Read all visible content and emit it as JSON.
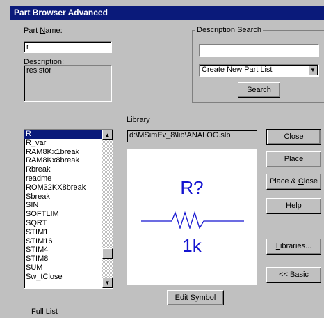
{
  "window": {
    "title": "Part Browser Advanced"
  },
  "part_name": {
    "label_pre": "Part ",
    "label_key": "N",
    "label_post": "ame:",
    "value": "r"
  },
  "description": {
    "label": "Description:",
    "value": "resistor"
  },
  "description_search": {
    "title_key": "D",
    "title_rest": "escription Search",
    "input_value": "",
    "combo_value": "Create New Part List",
    "search_key": "S",
    "search_rest": "earch"
  },
  "library": {
    "label": "Library",
    "path": "d:\\MSimEv_8\\lib\\ANALOG.slb"
  },
  "part_list": {
    "items": [
      "R",
      "R_var",
      "RAM8Kx1break",
      "RAM8Kx8break",
      "Rbreak",
      "readme",
      "ROM32KX8break",
      "Sbreak",
      "SIN",
      "SOFTLIM",
      "SQRT",
      "STIM1",
      "STIM16",
      "STIM4",
      "STIM8",
      "SUM",
      "Sw_tClose"
    ],
    "selected_index": 0
  },
  "symbol_preview": {
    "ref": "R?",
    "value": "1k",
    "color": "#1414d0"
  },
  "buttons": {
    "close": "Close",
    "place_key": "P",
    "place_rest": "lace",
    "place_close_pre": "Place & ",
    "place_close_key": "C",
    "place_close_rest": "lose",
    "help_key": "H",
    "help_rest": "elp",
    "libraries_key": "L",
    "libraries_rest": "ibraries...",
    "basic_pre": "<< ",
    "basic_key": "B",
    "basic_rest": "asic",
    "edit_symbol_key": "E",
    "edit_symbol_rest": "dit Symbol"
  },
  "footer": {
    "full_list": "Full List"
  },
  "colors": {
    "titlebar": "#0a1a7a",
    "face": "#c0c0c0",
    "selection": "#0a1a7a"
  }
}
